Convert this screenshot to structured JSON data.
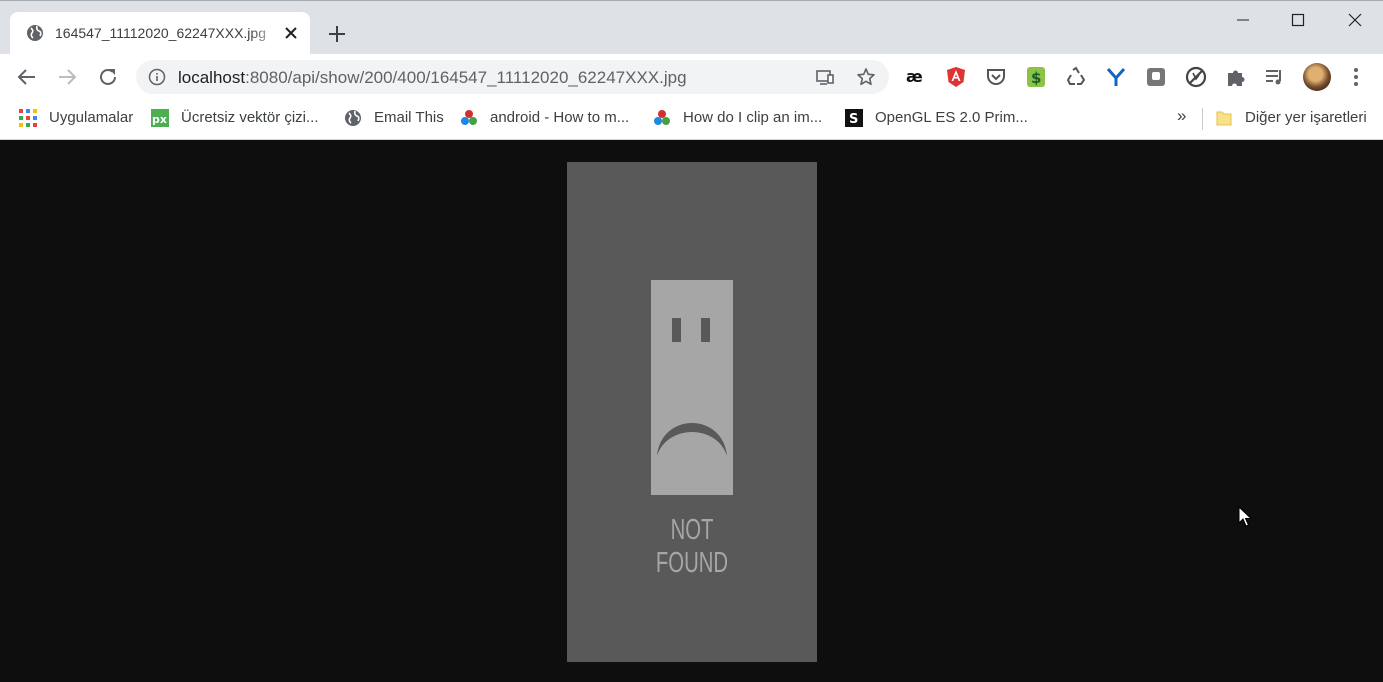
{
  "tab": {
    "title": "164547_11112020_62247XXX.jpg",
    "favicon": "globe-icon",
    "close_icon": "close-icon"
  },
  "window_controls": [
    "minimize-icon",
    "maximize-icon",
    "close-icon"
  ],
  "toolbar": {
    "back_icon": "back-arrow-icon",
    "forward_icon": "forward-arrow-icon",
    "reload_icon": "reload-icon",
    "url_host": "localhost",
    "url_rest": ":8080/api/show/200/400/164547_11112020_62247XXX.jpg",
    "omnibox_icons": [
      "cast-icon",
      "star-icon"
    ],
    "extensions": [
      "ae-extension-icon",
      "angular-extension-icon",
      "pocket-icon",
      "dollar-extension-icon",
      "recycle-icon",
      "y-extension-icon",
      "screenshot-extension-icon",
      "ban-extension-icon",
      "puzzle-icon",
      "media-control-icon"
    ],
    "profile_icon": "avatar",
    "menu_icon": "kebab-menu-icon"
  },
  "bookmarks": [
    {
      "label": "Uygulamalar",
      "icon": "apps-grid-icon"
    },
    {
      "label": "Ücretsiz vektör çizi...",
      "icon": "pixlr-icon"
    },
    {
      "label": "Email This",
      "icon": "globe-icon"
    },
    {
      "label": "android - How to m...",
      "icon": "cubes-icon"
    },
    {
      "label": "How do I clip an im...",
      "icon": "cubes-icon"
    },
    {
      "label": "OpenGL ES 2.0 Prim...",
      "icon": "s-icon"
    }
  ],
  "bookmarks_overflow": "»",
  "other_bookmarks": {
    "label": "Diğer yer işaretleri",
    "icon": "folder-icon"
  },
  "content": {
    "image_text": "NOT FOUND",
    "image_icon": "sad-face-icon"
  },
  "colors": {
    "page_background": "#0e0e0e",
    "image_background": "#595959",
    "face_color": "#a6a6a6"
  }
}
